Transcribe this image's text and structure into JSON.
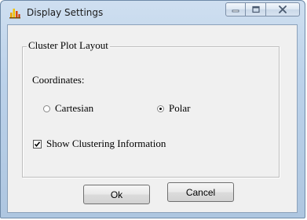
{
  "window": {
    "title": "Display Settings",
    "icon": "bar-chart-app-icon",
    "caption_buttons": [
      "minimize",
      "maximize",
      "close"
    ]
  },
  "group": {
    "title": "Cluster Plot Layout"
  },
  "coordinates": {
    "label": "Coordinates:",
    "options": [
      {
        "label": "Cartesian",
        "selected": false
      },
      {
        "label": "Polar",
        "selected": true
      }
    ]
  },
  "clustering": {
    "label": "Show Clustering Information",
    "checked": true
  },
  "buttons": {
    "ok": "Ok",
    "cancel": "Cancel"
  }
}
